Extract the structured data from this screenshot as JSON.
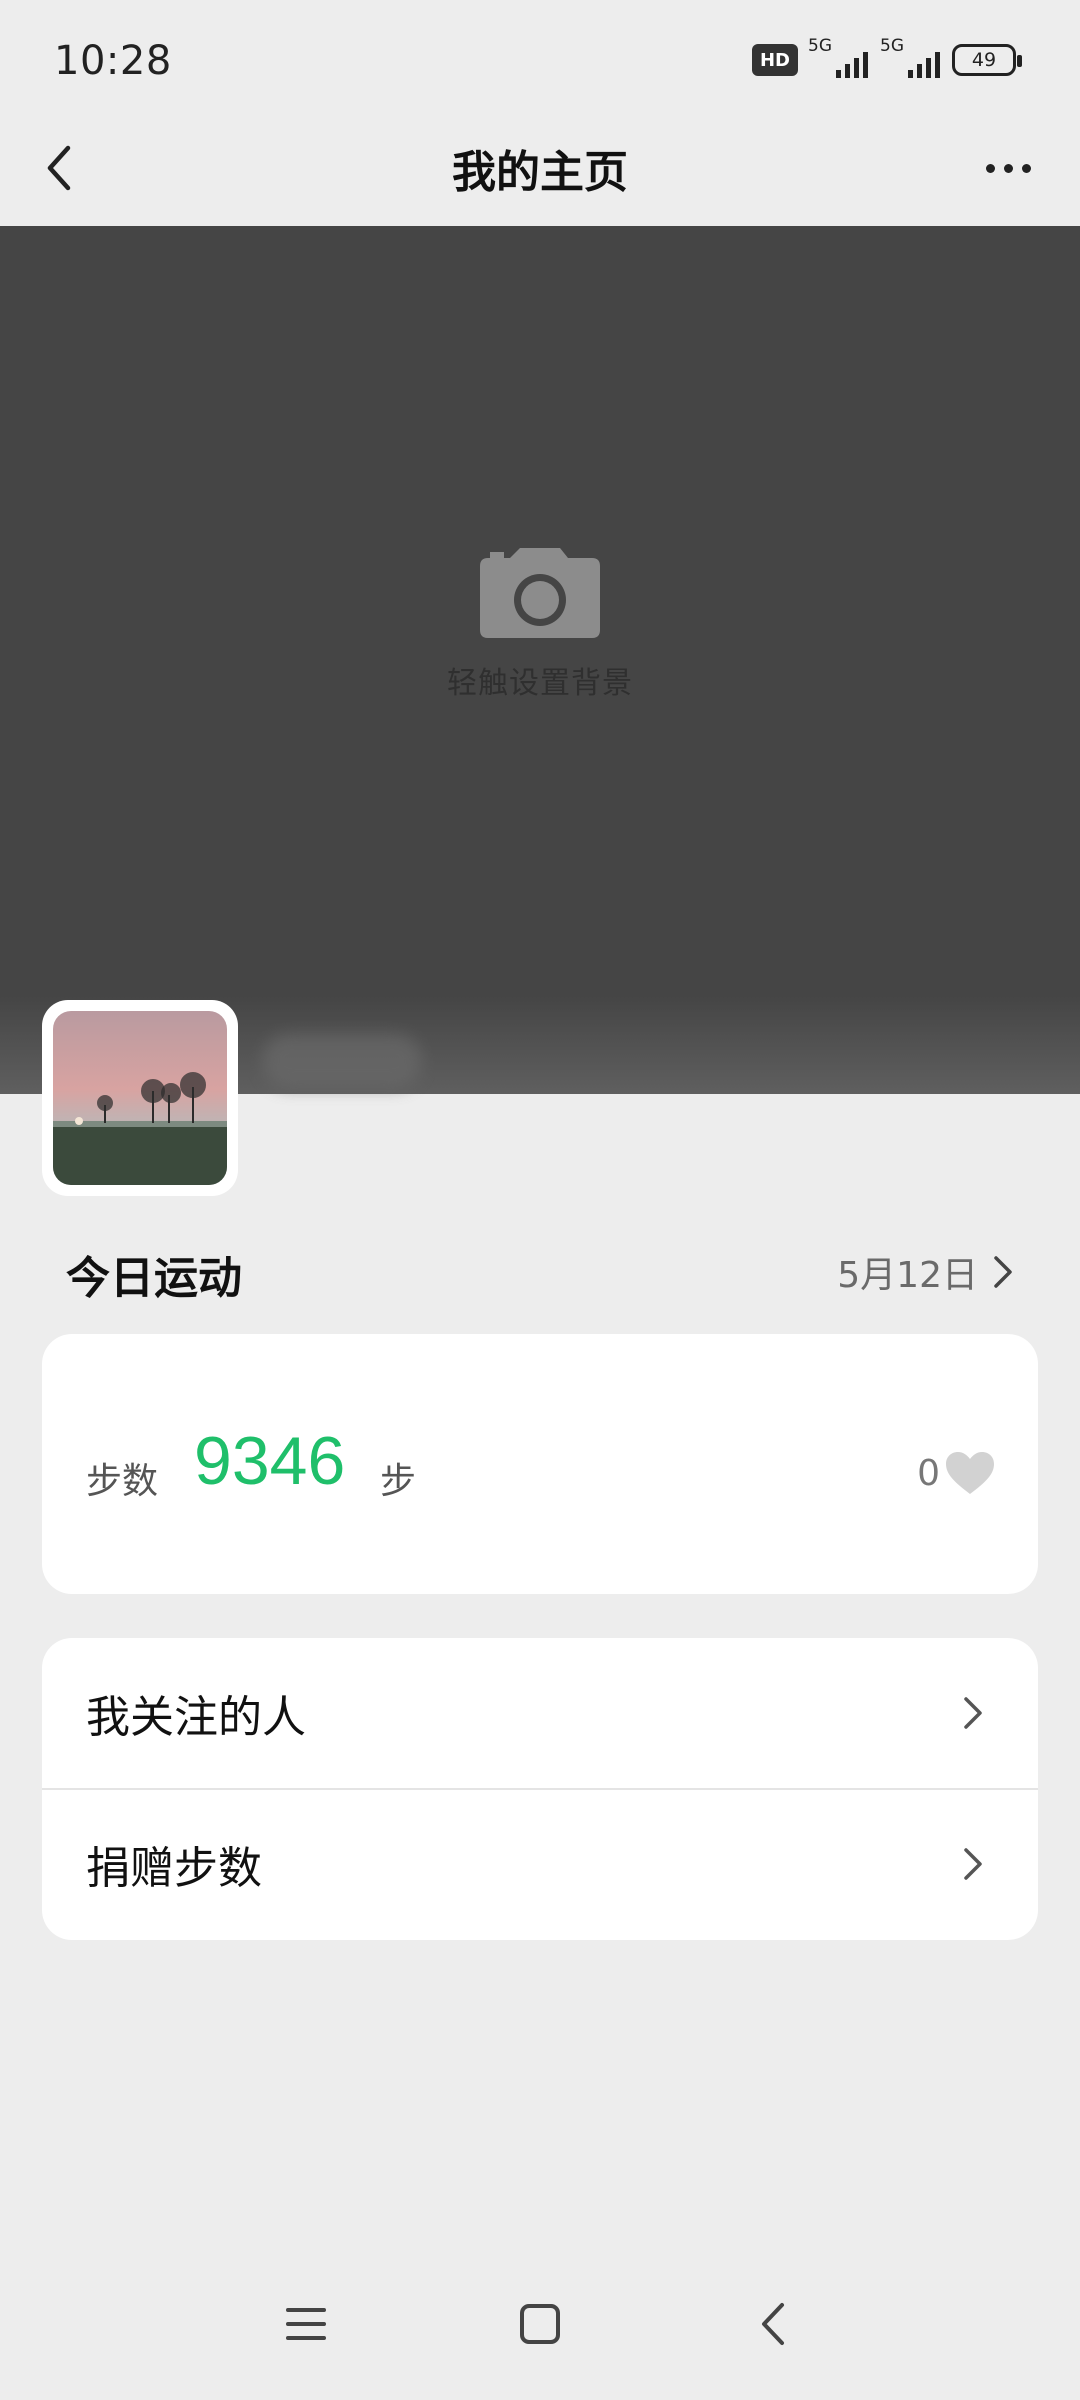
{
  "status_bar": {
    "time": "10:28",
    "hd_label": "HD",
    "network_1": "5G",
    "network_2": "5G",
    "battery": "49"
  },
  "header": {
    "title": "我的主页",
    "back_icon": "chevron-left-icon",
    "more_icon": "more-horizontal-icon"
  },
  "cover": {
    "hint": "轻触设置背景",
    "icon": "camera-icon"
  },
  "today": {
    "title": "今日运动",
    "date": "5月12日",
    "steps_label": "步数",
    "steps_value": "9346",
    "steps_unit": "步",
    "likes": "0"
  },
  "menu": {
    "items": [
      {
        "label": "我关注的人"
      },
      {
        "label": "捐赠步数"
      }
    ]
  },
  "nav": {
    "icons": [
      "menu-icon",
      "home-icon",
      "back-icon"
    ]
  },
  "colors": {
    "accent_green": "#1fbf6a",
    "cover_bg": "#454545",
    "page_bg": "#ededed"
  }
}
